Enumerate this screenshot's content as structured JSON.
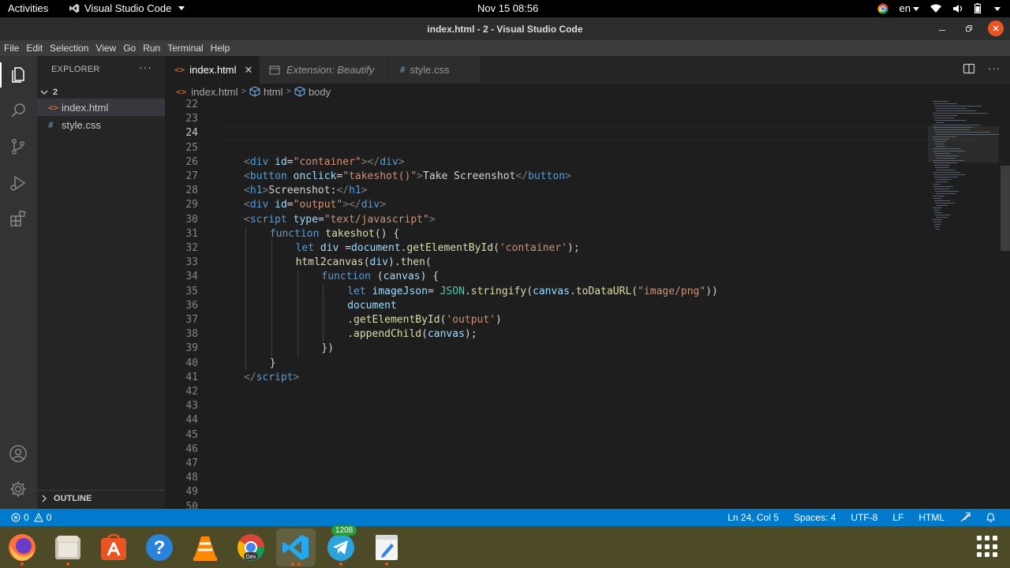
{
  "topbar": {
    "activities": "Activities",
    "app_name": "Visual Studio Code",
    "clock": "Nov 15  08:56",
    "language": "en"
  },
  "window": {
    "title": "index.html - 2 - Visual Studio Code"
  },
  "menu": [
    "File",
    "Edit",
    "Selection",
    "View",
    "Go",
    "Run",
    "Terminal",
    "Help"
  ],
  "activitybar": {
    "icons": [
      "explorer-icon",
      "search-icon",
      "source-control-icon",
      "run-debug-icon",
      "extensions-icon",
      "accounts-icon",
      "manage-gear-icon"
    ]
  },
  "sidebar": {
    "header": "EXPLORER",
    "folder": "2",
    "files": [
      {
        "name": "index.html",
        "icon": "<>",
        "selected": true
      },
      {
        "name": "style.css",
        "icon": "#",
        "selected": false
      }
    ],
    "outline": "OUTLINE"
  },
  "tabs": [
    {
      "label": "index.html",
      "icon": "<>",
      "active": true
    },
    {
      "label": "Extension: Beautify",
      "active": false
    },
    {
      "label": "style.css",
      "icon": "#",
      "active": false
    }
  ],
  "breadcrumb": [
    "index.html",
    "html",
    "body"
  ],
  "editor": {
    "current_line": 24,
    "lines": [
      {
        "n": "22",
        "indent": 0,
        "tokens": []
      },
      {
        "n": "23",
        "indent": 0,
        "tokens": []
      },
      {
        "n": "24",
        "indent": 0,
        "tokens": []
      },
      {
        "n": "25",
        "indent": 0,
        "tokens": []
      },
      {
        "n": "26",
        "indent": 0,
        "tokens": [
          [
            "punc",
            "<"
          ],
          [
            "tag",
            "div"
          ],
          [
            "plain",
            " "
          ],
          [
            "attr",
            "id"
          ],
          [
            "plain",
            "="
          ],
          [
            "str",
            "\"container\""
          ],
          [
            "punc",
            ">"
          ],
          [
            "punc",
            "</"
          ],
          [
            "tag",
            "div"
          ],
          [
            "punc",
            ">"
          ]
        ]
      },
      {
        "n": "27",
        "indent": 0,
        "tokens": [
          [
            "punc",
            "<"
          ],
          [
            "tag",
            "button"
          ],
          [
            "plain",
            " "
          ],
          [
            "attr",
            "onclick"
          ],
          [
            "plain",
            "="
          ],
          [
            "str",
            "\"takeshot()\""
          ],
          [
            "punc",
            ">"
          ],
          [
            "text",
            "Take Screenshot"
          ],
          [
            "punc",
            "</"
          ],
          [
            "tag",
            "button"
          ],
          [
            "punc",
            ">"
          ]
        ]
      },
      {
        "n": "28",
        "indent": 0,
        "tokens": [
          [
            "punc",
            "<"
          ],
          [
            "tag",
            "h1"
          ],
          [
            "punc",
            ">"
          ],
          [
            "text",
            "Screenshot:"
          ],
          [
            "punc",
            "</"
          ],
          [
            "tag",
            "h1"
          ],
          [
            "punc",
            ">"
          ]
        ]
      },
      {
        "n": "29",
        "indent": 0,
        "tokens": [
          [
            "punc",
            "<"
          ],
          [
            "tag",
            "div"
          ],
          [
            "plain",
            " "
          ],
          [
            "attr",
            "id"
          ],
          [
            "plain",
            "="
          ],
          [
            "str",
            "\"output\""
          ],
          [
            "punc",
            ">"
          ],
          [
            "punc",
            "</"
          ],
          [
            "tag",
            "div"
          ],
          [
            "punc",
            ">"
          ]
        ]
      },
      {
        "n": "30",
        "indent": 0,
        "tokens": [
          [
            "punc",
            "<"
          ],
          [
            "tag",
            "script"
          ],
          [
            "plain",
            " "
          ],
          [
            "attr",
            "type"
          ],
          [
            "plain",
            "="
          ],
          [
            "str",
            "\"text/javascript\""
          ],
          [
            "punc",
            ">"
          ]
        ]
      },
      {
        "n": "31",
        "indent": 1,
        "tokens": [
          [
            "kw",
            "function"
          ],
          [
            "plain",
            " "
          ],
          [
            "fn",
            "takeshot"
          ],
          [
            "plain",
            "() {"
          ]
        ]
      },
      {
        "n": "32",
        "indent": 2,
        "tokens": [
          [
            "kw",
            "let"
          ],
          [
            "plain",
            " "
          ],
          [
            "var",
            "div"
          ],
          [
            "plain",
            " ="
          ],
          [
            "var",
            "document"
          ],
          [
            "plain",
            "."
          ],
          [
            "fn",
            "getElementById"
          ],
          [
            "plain",
            "("
          ],
          [
            "str",
            "'container'"
          ],
          [
            "plain",
            ");"
          ]
        ]
      },
      {
        "n": "33",
        "indent": 2,
        "tokens": [
          [
            "fn",
            "html2canvas"
          ],
          [
            "plain",
            "("
          ],
          [
            "var",
            "div"
          ],
          [
            "plain",
            ")."
          ],
          [
            "fn",
            "then"
          ],
          [
            "plain",
            "("
          ]
        ]
      },
      {
        "n": "34",
        "indent": 3,
        "tokens": [
          [
            "kw",
            "function"
          ],
          [
            "plain",
            " ("
          ],
          [
            "var",
            "canvas"
          ],
          [
            "plain",
            ") {"
          ]
        ]
      },
      {
        "n": "35",
        "indent": 4,
        "tokens": [
          [
            "kw",
            "let"
          ],
          [
            "plain",
            " "
          ],
          [
            "var",
            "imageJson"
          ],
          [
            "plain",
            "= "
          ],
          [
            "cls",
            "JSON"
          ],
          [
            "plain",
            "."
          ],
          [
            "fn",
            "stringify"
          ],
          [
            "plain",
            "("
          ],
          [
            "var",
            "canvas"
          ],
          [
            "plain",
            "."
          ],
          [
            "fn",
            "toDataURL"
          ],
          [
            "plain",
            "("
          ],
          [
            "str",
            "\"image/png\""
          ],
          [
            "plain",
            "))"
          ]
        ]
      },
      {
        "n": "36",
        "indent": 4,
        "tokens": [
          [
            "var",
            "document"
          ]
        ]
      },
      {
        "n": "37",
        "indent": 4,
        "tokens": [
          [
            "plain",
            "."
          ],
          [
            "fn",
            "getElementById"
          ],
          [
            "plain",
            "("
          ],
          [
            "str",
            "'output'"
          ],
          [
            "plain",
            ")"
          ]
        ]
      },
      {
        "n": "38",
        "indent": 4,
        "tokens": [
          [
            "plain",
            "."
          ],
          [
            "fn",
            "appendChild"
          ],
          [
            "plain",
            "("
          ],
          [
            "var",
            "canvas"
          ],
          [
            "plain",
            ");"
          ]
        ]
      },
      {
        "n": "39",
        "indent": 3,
        "tokens": [
          [
            "plain",
            "})"
          ]
        ]
      },
      {
        "n": "40",
        "indent": 1,
        "tokens": [
          [
            "plain",
            "}"
          ]
        ]
      },
      {
        "n": "41",
        "indent": 0,
        "tokens": [
          [
            "punc",
            "</"
          ],
          [
            "tag",
            "script"
          ],
          [
            "punc",
            ">"
          ]
        ]
      },
      {
        "n": "42",
        "indent": 0,
        "tokens": []
      },
      {
        "n": "43",
        "indent": 0,
        "tokens": []
      },
      {
        "n": "44",
        "indent": 0,
        "tokens": []
      },
      {
        "n": "45",
        "indent": 0,
        "tokens": []
      },
      {
        "n": "46",
        "indent": 0,
        "tokens": []
      },
      {
        "n": "47",
        "indent": 0,
        "tokens": []
      },
      {
        "n": "48",
        "indent": 0,
        "tokens": []
      },
      {
        "n": "49",
        "indent": 0,
        "tokens": []
      },
      {
        "n": "50",
        "indent": 0,
        "tokens": []
      }
    ]
  },
  "statusbar": {
    "errors": "0",
    "warnings": "0",
    "position": "Ln 24, Col 5",
    "spaces": "Spaces: 4",
    "encoding": "UTF-8",
    "eol": "LF",
    "language": "HTML"
  },
  "dock": {
    "apps": [
      {
        "name": "firefox",
        "running": true
      },
      {
        "name": "files",
        "running": true
      },
      {
        "name": "ubuntu-software",
        "running": false
      },
      {
        "name": "help",
        "running": false
      },
      {
        "name": "vlc",
        "running": false
      },
      {
        "name": "chrome-dev",
        "running": false,
        "label": "Dev"
      },
      {
        "name": "vscode",
        "running": true
      },
      {
        "name": "telegram",
        "running": true,
        "badge": "1208"
      },
      {
        "name": "text-editor",
        "running": true
      }
    ]
  },
  "colors": {
    "accent": "#007acc",
    "ubuntu_orange": "#e95420"
  }
}
